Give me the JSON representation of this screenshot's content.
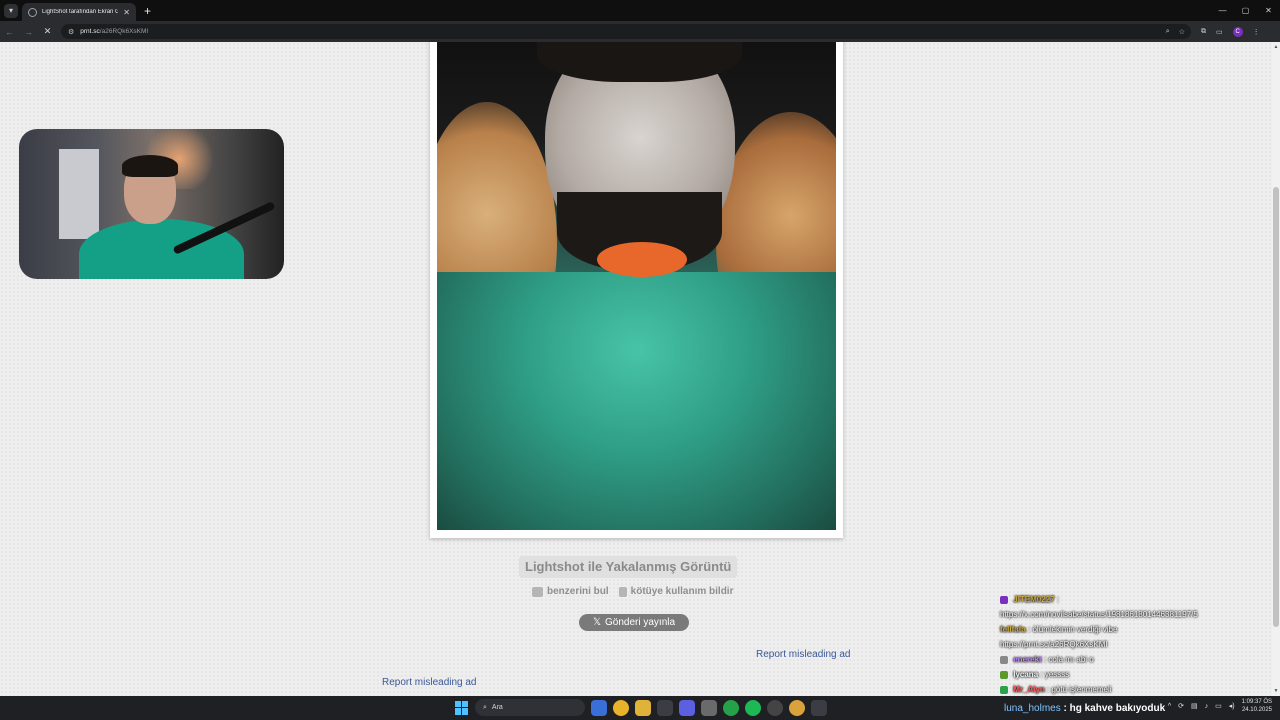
{
  "browser": {
    "tab_title": "LightShot tarafından Ekran Gör",
    "tab_close": "✕",
    "new_tab": "+",
    "url_host": "prnt.sc",
    "url_path": "/a26RQk6XsKMI",
    "window_controls": [
      "—",
      "▢",
      "✕"
    ],
    "profile_initial": "C"
  },
  "page": {
    "title": "Lightshot ile Yakalanmış Görüntü",
    "action_similar": "benzerini bul",
    "action_report_abuse": "kötüye kullanım bildir",
    "post_button": "Gönderi yayınla",
    "post_icon": "𝕏",
    "report_ad_1": "Report misleading ad",
    "report_ad_2": "Report misleading ad"
  },
  "chat": {
    "messages": [
      {
        "user": "JITEM0227",
        "text": ":",
        "user_color": "#c9a640",
        "badge_color": "#7b2fbf"
      },
      {
        "user": "",
        "text": "https://x.com/novilsabe/status/1981861801446381197/5",
        "user_color": "#ffffff",
        "badge_color": ""
      },
      {
        "user": "fellfafa",
        "text": ": ölümlekimin verdiği vibe",
        "user_color": "#c9a640",
        "badge_color": ""
      },
      {
        "user": "",
        "text": "https://prnt.sc/a26RQk6XsKMI",
        "user_color": "#ffffff",
        "badge_color": ""
      },
      {
        "user": "enerekt",
        "text": ": cola mı abi o",
        "user_color": "#c080ff",
        "badge_color": "#888888"
      },
      {
        "user": "lycana",
        "text": ": yessss",
        "user_color": "#ffffff",
        "badge_color": "#5a9a2a"
      },
      {
        "user": "Mr_Alyn",
        "text": ": götü işlenmemeli",
        "user_color": "#ff5a5a",
        "badge_color": "#2aa14a"
      }
    ]
  },
  "stream_message": {
    "user": "luna_holmes",
    "text": ": hg kahve bakıyoduk"
  },
  "taskbar": {
    "search_label": "Ara",
    "time": "1:09:37 ÖS",
    "date": "24.10.2025"
  }
}
